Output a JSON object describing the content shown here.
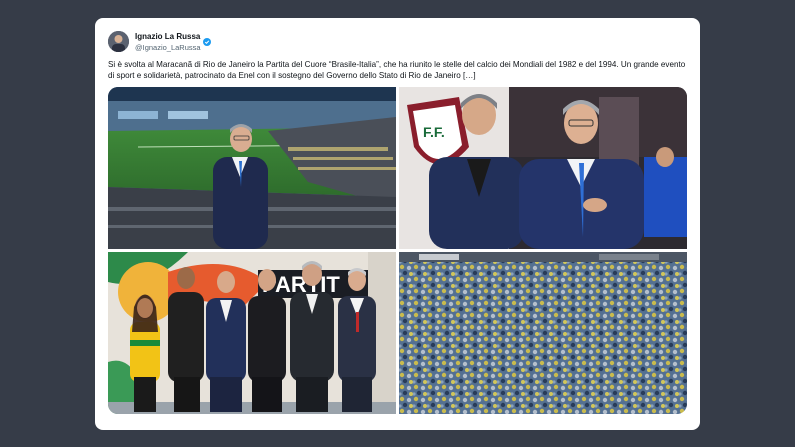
{
  "tweet": {
    "display_name": "Ignazio La Russa",
    "handle": "@Ignazio_LaRussa",
    "text": "Si è svolta al Maracanã di Rio de Janeiro la Partita del Cuore “Brasile-Italia”, che ha riunito le stelle del calcio dei Mondiali del 1982 e del 1994. Un grande evento di sport e solidarietà, patrocinato da Enel con il sostegno del Governo dello Stato di Rio de Janeiro […]"
  },
  "icons": {
    "verified": "verified-badge-icon"
  },
  "colors": {
    "background": "#363c48",
    "card": "#ffffff",
    "verified": "#1d9bf0",
    "handle": "#536471"
  },
  "photos": {
    "crest_text": "F.F.",
    "banner_text": "PARTIT"
  }
}
